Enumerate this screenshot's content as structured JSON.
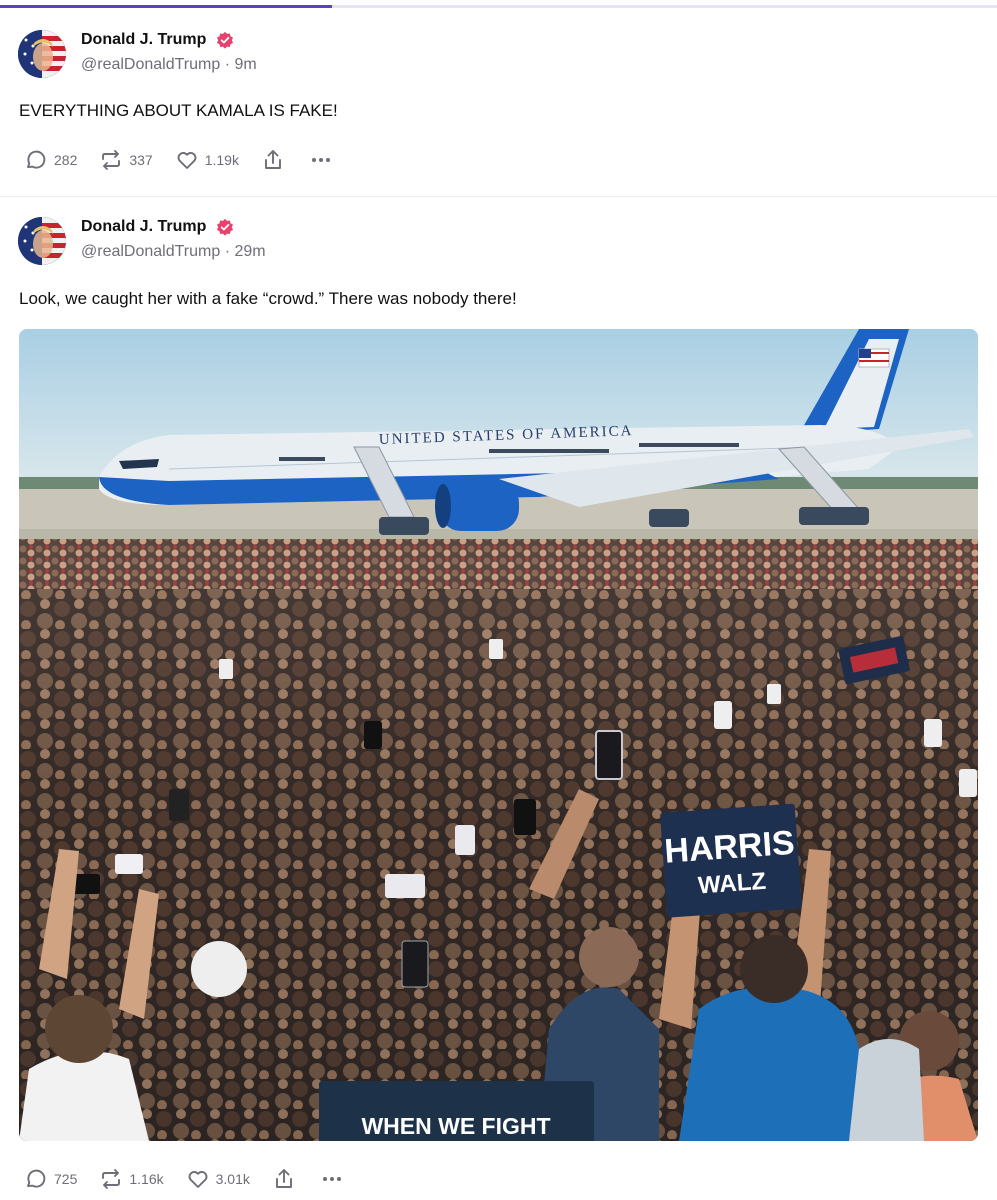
{
  "progress": {
    "fraction": 0.333,
    "color": "#5b3fd1"
  },
  "posts": [
    {
      "author": "Donald J. Trump",
      "handle": "@realDonaldTrump",
      "separator": "·",
      "time": "9m",
      "text": "EVERYTHING ABOUT KAMALA IS FAKE!",
      "replies": "282",
      "reposts": "337",
      "likes": "1.19k"
    },
    {
      "author": "Donald J. Trump",
      "handle": "@realDonaldTrump",
      "separator": "·",
      "time": "29m",
      "text": "Look, we caught her with a fake “crowd.” There was nobody there!",
      "replies": "725",
      "reposts": "1.16k",
      "likes": "3.01k",
      "photo": {
        "plane_text": "UNITED STATES OF AMERICA",
        "signs": [
          "HARRIS",
          "WALZ",
          "WHEN WE FIGHT"
        ]
      }
    }
  ],
  "icons": {
    "verified": "verified-badge-icon",
    "reply": "reply-icon",
    "repost": "repost-icon",
    "like": "heart-icon",
    "share": "share-icon",
    "more": "more-dots-icon"
  },
  "colors": {
    "verified": "#e8416e",
    "text": "#111111",
    "muted": "#6e6e78",
    "plane_blue": "#1c63c4"
  }
}
